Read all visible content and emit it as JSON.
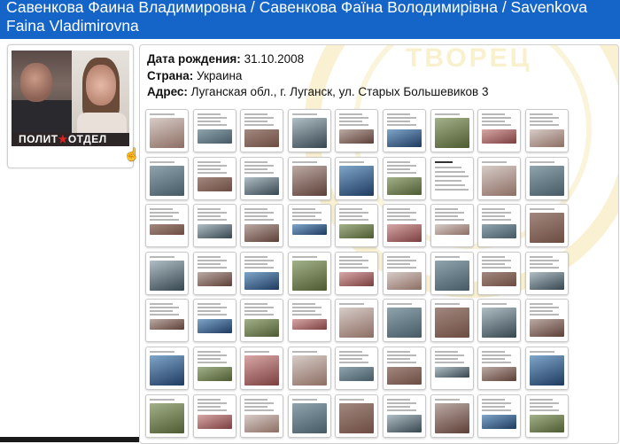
{
  "header": {
    "title": "Савенкова Фаина Владимировна / Савенкова Фаїна Володимирівна / Savenkova Faina Vladimirovna"
  },
  "profile": {
    "photo_banner": "ПОЛИТ ОТДЕЛ",
    "birth_label": "Дата рождения:",
    "birth_value": "31.10.2008",
    "country_label": "Страна:",
    "country_value": "Украина",
    "address_label": "Адрес:",
    "address_value": "Луганская обл., г. Луганск, ул. Старых Большевиков 3"
  },
  "watermark_text": "ТВОРЕЦ",
  "colors": {
    "header_bg": "#1565c8",
    "header_text": "#ffffff",
    "watermark": "#eacd5a"
  },
  "thumbnails": [
    "video",
    "doc",
    "doc",
    "photo",
    "doc",
    "doc",
    "photo",
    "doc",
    "doc",
    "photo",
    "doc",
    "doc",
    "photo",
    "photo",
    "doc",
    "news",
    "photo",
    "photo",
    "doc",
    "doc",
    "doc",
    "doc",
    "doc",
    "doc",
    "doc",
    "doc",
    "photo",
    "photo",
    "doc",
    "doc",
    "photo",
    "doc",
    "doc",
    "photo",
    "doc",
    "doc",
    "doc",
    "doc",
    "doc",
    "doc",
    "photo",
    "photo",
    "photo",
    "photo",
    "doc",
    "photo",
    "doc",
    "photo",
    "photo",
    "doc",
    "doc",
    "doc",
    "doc",
    "photo",
    "photo",
    "doc",
    "doc",
    "photo",
    "photo",
    "doc",
    "photo",
    "doc",
    "doc"
  ]
}
